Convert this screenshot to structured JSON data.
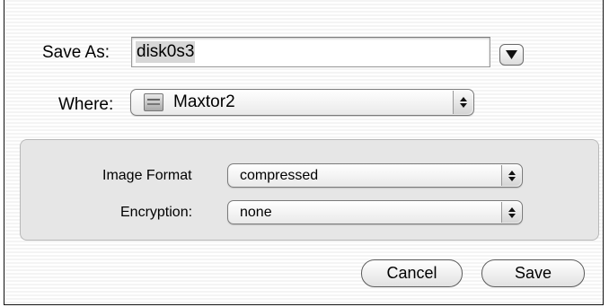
{
  "save_as": {
    "label": "Save As:",
    "value": "disk0s3"
  },
  "expand_icon": "triangle-down-icon",
  "where": {
    "label": "Where:",
    "value": "Maxtor2",
    "icon": "hard-disk-icon"
  },
  "options": {
    "image_format": {
      "label": "Image Format",
      "value": "compressed"
    },
    "encryption": {
      "label": "Encryption:",
      "value": "none"
    }
  },
  "buttons": {
    "cancel": "Cancel",
    "save": "Save"
  }
}
